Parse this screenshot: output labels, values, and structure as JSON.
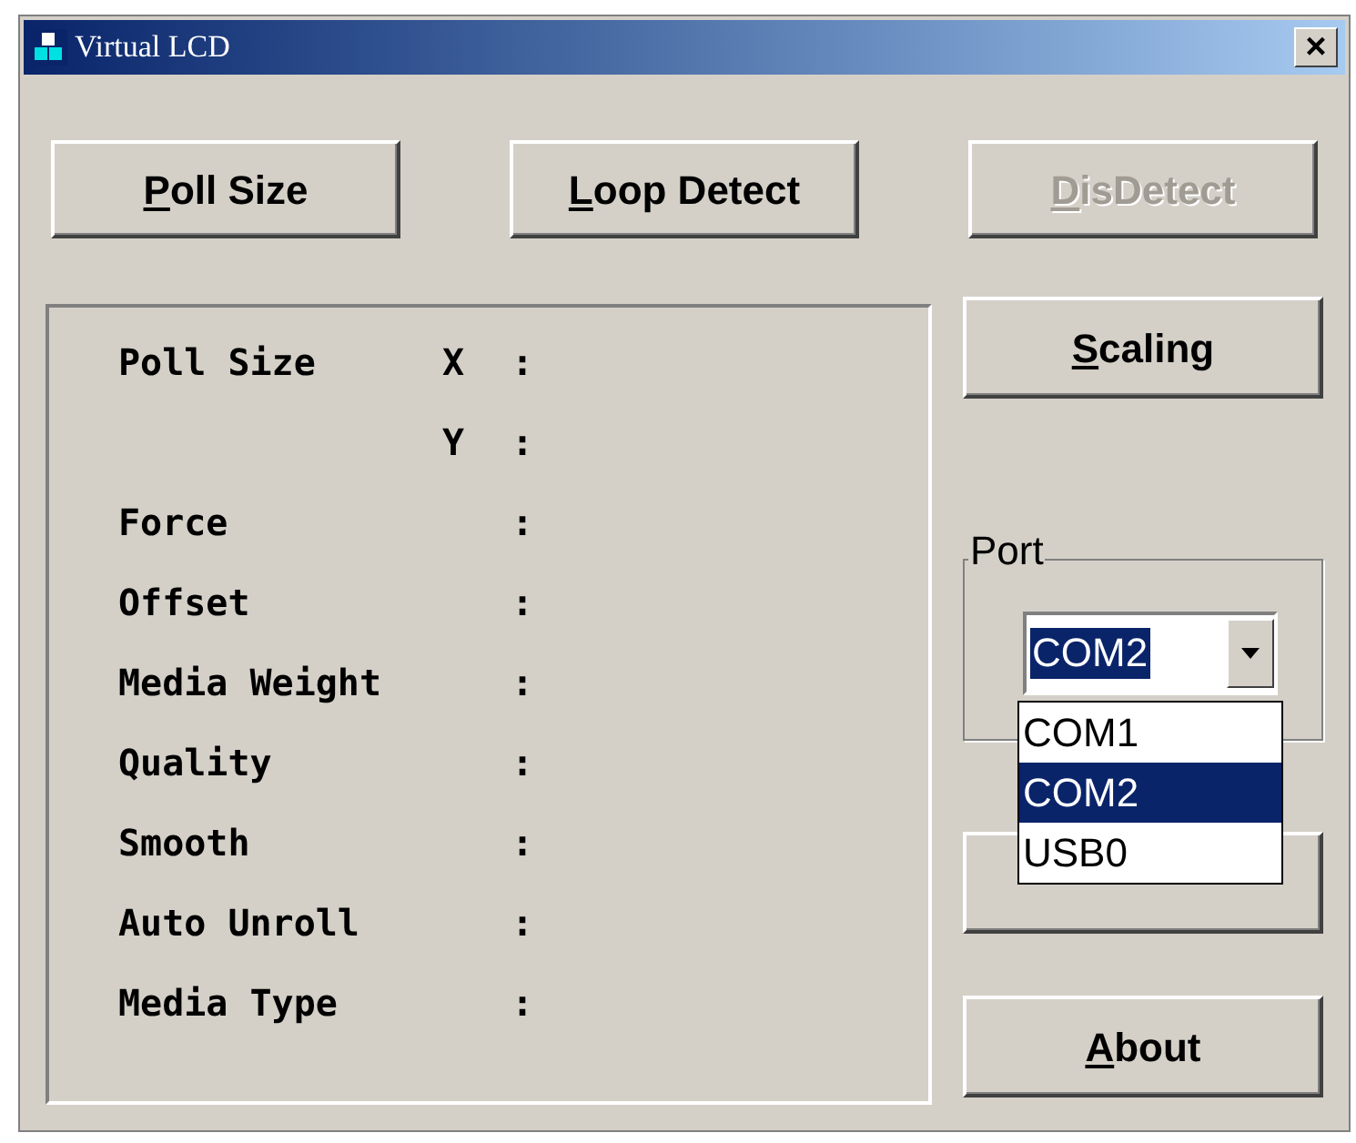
{
  "window": {
    "title": "Virtual LCD",
    "close": "×"
  },
  "top_buttons": [
    {
      "label": "Poll Size",
      "disabled": false
    },
    {
      "label": "Loop Detect",
      "disabled": false
    },
    {
      "label": "DisDetect",
      "disabled": true
    }
  ],
  "info_rows": [
    {
      "label": "Poll Size",
      "axis": "X",
      "separator": ":"
    },
    {
      "axis": "Y",
      "separator": ":"
    },
    {
      "label": "Force",
      "separator": ":"
    },
    {
      "label": "Offset",
      "separator": ":"
    },
    {
      "label": "Media Weight",
      "separator": ":"
    },
    {
      "label": "Quality",
      "separator": ":"
    },
    {
      "label": "Smooth",
      "separator": ":"
    },
    {
      "label": "Auto Unroll",
      "separator": ":"
    },
    {
      "label": "Media Type",
      "separator": ":"
    }
  ],
  "scaling_button": {
    "label": "Scaling"
  },
  "port": {
    "label": "Port",
    "value": "COM2",
    "options": [
      {
        "label": "COM1",
        "selected": false
      },
      {
        "label": "COM2",
        "selected": true
      },
      {
        "label": "USB0",
        "selected": false
      }
    ]
  },
  "about_button": {
    "label": "About"
  }
}
